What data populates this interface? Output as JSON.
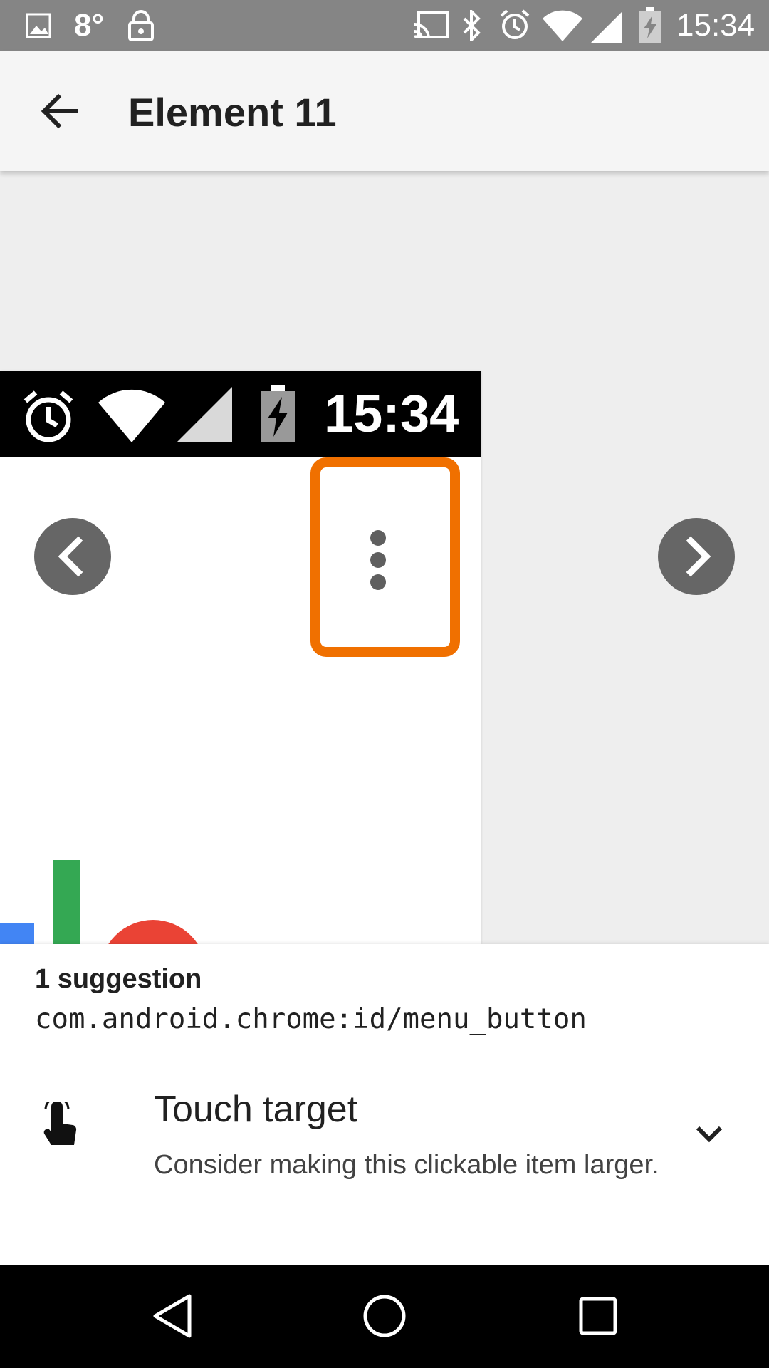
{
  "status_bar": {
    "temperature": "8°",
    "time": "15:34",
    "icons": [
      "image-icon",
      "lock-icon",
      "cast-icon",
      "bluetooth-icon",
      "alarm-icon",
      "wifi-icon",
      "signal-icon",
      "battery-charging-icon"
    ]
  },
  "app_bar": {
    "title": "Element 11",
    "back_icon": "arrow-back-icon"
  },
  "preview": {
    "status_time": "15:34",
    "highlight_color": "#f07000",
    "prev_icon": "chevron-left-icon",
    "next_icon": "chevron-right-icon",
    "menu_icon": "more-vert-icon"
  },
  "suggestions": {
    "count_label": "1 suggestion",
    "resource_id": "com.android.chrome:id/menu_button",
    "items": [
      {
        "icon": "touch-icon",
        "title": "Touch target",
        "description": "Consider making this clickable item larger."
      }
    ]
  },
  "nav_bar": {
    "icons": [
      "back-nav-icon",
      "home-nav-icon",
      "recents-nav-icon"
    ]
  }
}
